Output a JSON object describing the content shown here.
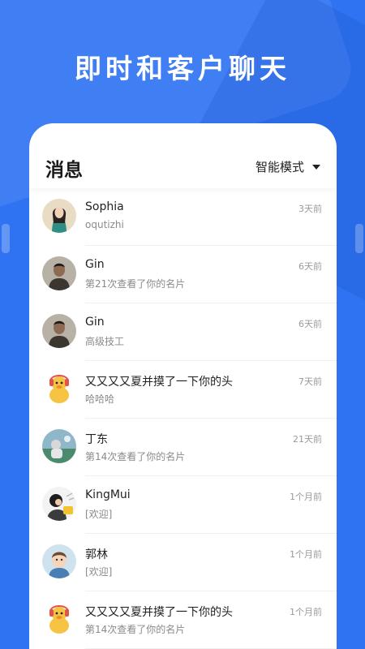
{
  "headline": "即时和客户聊天",
  "header": {
    "title": "消息",
    "mode_label": "智能模式"
  },
  "conversations": [
    {
      "name": "Sophia",
      "preview": "oqutizhi",
      "time": "3天前",
      "avatar": "woman-portrait"
    },
    {
      "name": "Gin",
      "preview": "第21次查看了你的名片",
      "time": "6天前",
      "avatar": "man-portrait"
    },
    {
      "name": "Gin",
      "preview": "高级技工",
      "time": "6天前",
      "avatar": "man-portrait"
    },
    {
      "name": "又又又又夏并摸了一下你的头",
      "preview": "哈哈哈",
      "time": "7天前",
      "avatar": "duck-cartoon"
    },
    {
      "name": "丁东",
      "preview": "第14次查看了你的名片",
      "time": "21天前",
      "avatar": "outdoor-photo"
    },
    {
      "name": "KingMui",
      "preview": "[欢迎]",
      "time": "1个月前",
      "avatar": "cartoon-person"
    },
    {
      "name": "郭林",
      "preview": "[欢迎]",
      "time": "1个月前",
      "avatar": "child-portrait"
    },
    {
      "name": "又又又又夏并摸了一下你的头",
      "preview": "第14次查看了你的名片",
      "time": "1个月前",
      "avatar": "duck-cartoon"
    }
  ]
}
